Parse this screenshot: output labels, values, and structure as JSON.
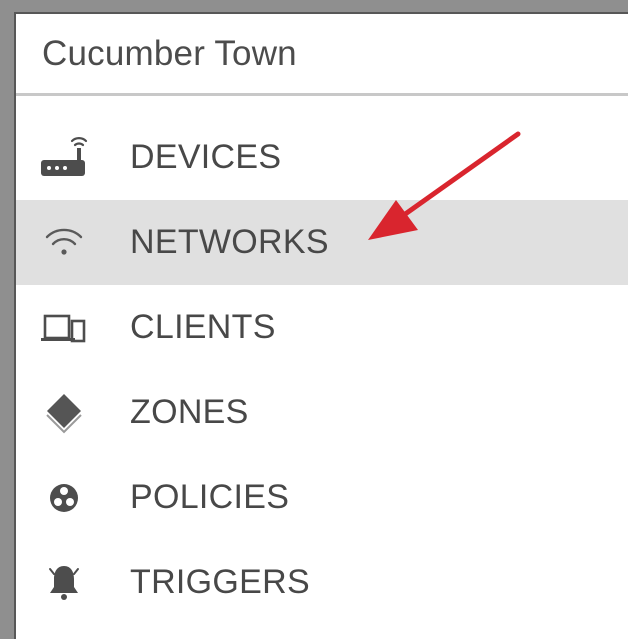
{
  "header": {
    "title": "Cucumber Town"
  },
  "nav": {
    "items": [
      {
        "label": "DEVICES",
        "icon": "router-icon"
      },
      {
        "label": "NETWORKS",
        "icon": "wifi-icon",
        "active": true
      },
      {
        "label": "CLIENTS",
        "icon": "client-devices-icon"
      },
      {
        "label": "ZONES",
        "icon": "diamond-icon"
      },
      {
        "label": "POLICIES",
        "icon": "policy-icon"
      },
      {
        "label": "TRIGGERS",
        "icon": "bell-icon"
      }
    ]
  },
  "colors": {
    "active_background": "#e0e0e0",
    "annotation_arrow": "#d9252e",
    "text": "#484848",
    "window_frame": "#8f8f8f"
  }
}
